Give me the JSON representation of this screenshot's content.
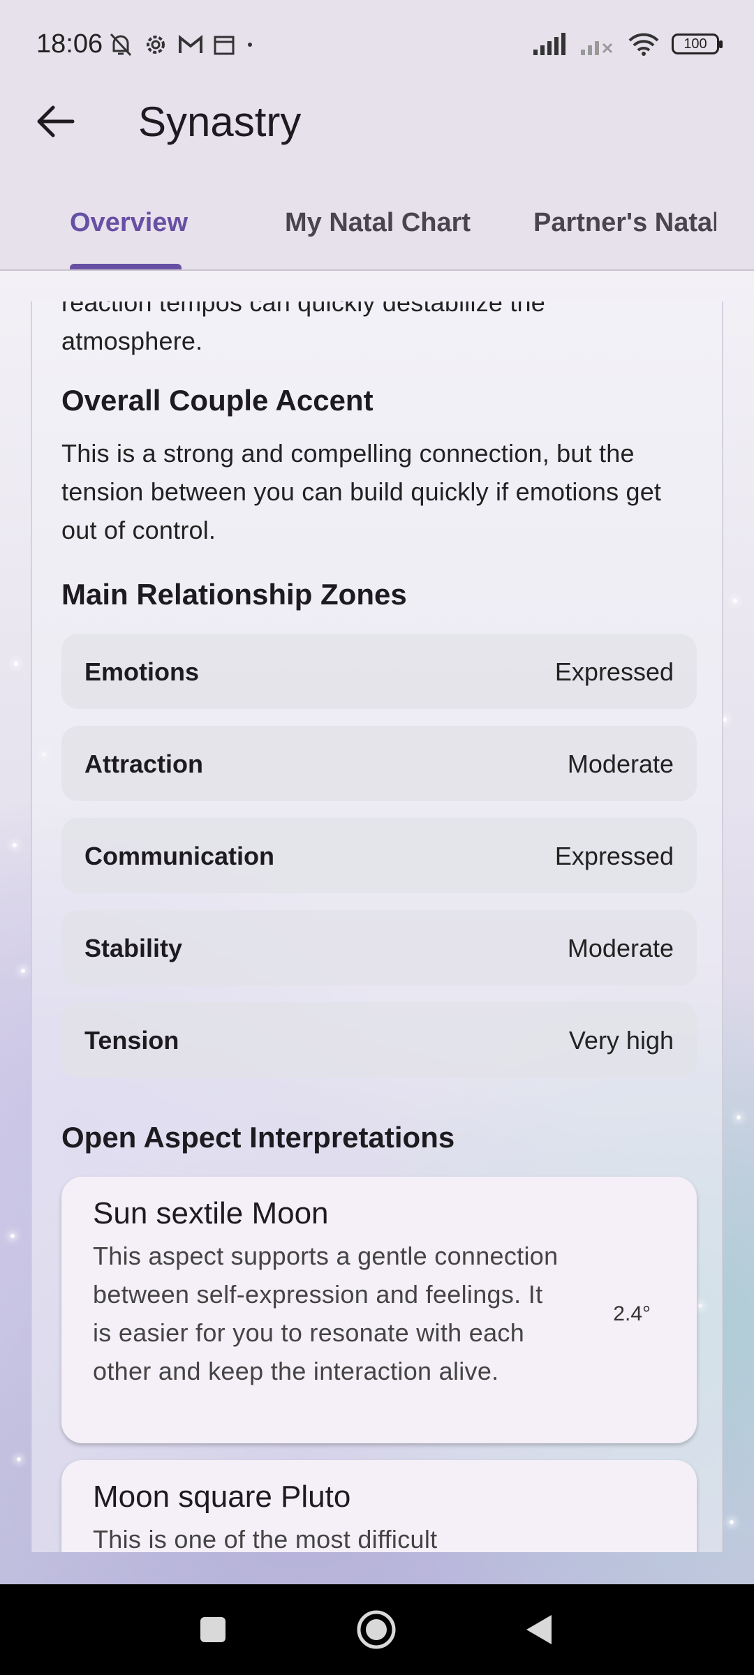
{
  "status_bar": {
    "time": "18:06",
    "battery": "100"
  },
  "app_bar": {
    "title": "Synastry"
  },
  "tabs": [
    {
      "label": "Overview",
      "active": true
    },
    {
      "label": "My Natal Chart",
      "active": false
    },
    {
      "label": "Partner's Natal",
      "active": false
    }
  ],
  "content": {
    "cut_top_line": "reaction tempos can quickly destabilize the",
    "intro_tail": "atmosphere.",
    "accent_heading": "Overall Couple Accent",
    "accent_text": "This is a strong and compelling connection, but the tension between you can build quickly if emotions get out of control.",
    "zones_heading": "Main Relationship Zones",
    "zones": [
      {
        "label": "Emotions",
        "value": "Expressed"
      },
      {
        "label": "Attraction",
        "value": "Moderate"
      },
      {
        "label": "Communication",
        "value": "Expressed"
      },
      {
        "label": "Stability",
        "value": "Moderate"
      },
      {
        "label": "Tension",
        "value": "Very high"
      }
    ],
    "aspects_heading": "Open Aspect Interpretations",
    "aspects": [
      {
        "name": "Sun sextile Moon",
        "description": "This aspect supports a gentle connection between self-expression and feelings. It is easier for you to resonate with each other and keep the interaction alive.",
        "orb": "2.4°"
      },
      {
        "name": "Moon square Pluto",
        "description": "This is one of the most difficult"
      }
    ]
  },
  "colors": {
    "accent": "#6750a4",
    "app_bar_bg": "#e7e1ec",
    "card_bg": "#f5eff7"
  }
}
